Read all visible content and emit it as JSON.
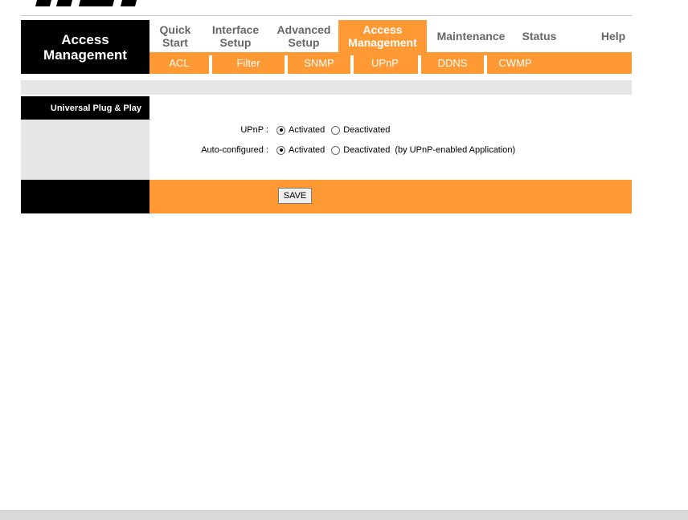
{
  "brand": {
    "logo_text": "msi",
    "icon": "msi-logo"
  },
  "page_title": "Access\nManagement",
  "nav": [
    {
      "label": "Quick\nStart",
      "active": false
    },
    {
      "label": "Interface\nSetup",
      "active": false
    },
    {
      "label": "Advanced\nSetup",
      "active": false
    },
    {
      "label": "Access\nManagement",
      "active": true
    },
    {
      "label": "Maintenance",
      "active": false
    },
    {
      "label": "Status",
      "active": false
    },
    {
      "label": "Help",
      "active": false
    }
  ],
  "subnav": [
    "ACL",
    "Filter",
    "SNMP",
    "UPnP",
    "DDNS",
    "CWMP"
  ],
  "section": {
    "title": "Universal Plug & Play"
  },
  "upnp": {
    "label": "UPnP :",
    "options": [
      "Activated",
      "Deactivated"
    ],
    "selected": "Activated"
  },
  "auto_config": {
    "label": "Auto-configured :",
    "options": [
      "Activated",
      "Deactivated"
    ],
    "selected": "Activated",
    "note": "(by UPnP-enabled Application)"
  },
  "buttons": {
    "save": "SAVE"
  },
  "colors": {
    "accent": "#ff9933",
    "dark": "#000000",
    "panel_gray": "#e6e6e6",
    "nav_text": "#666666"
  }
}
